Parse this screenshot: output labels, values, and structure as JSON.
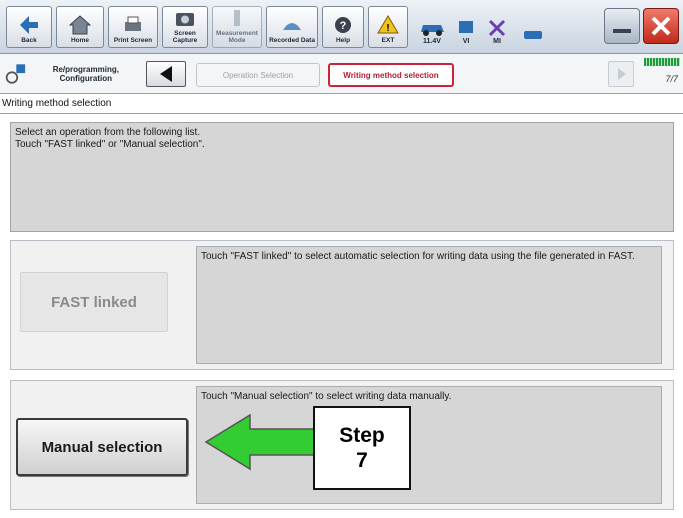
{
  "toolbar": {
    "buttons": [
      {
        "label": "Back"
      },
      {
        "label": "Home"
      },
      {
        "label": "Print Screen"
      },
      {
        "label": "Screen Capture"
      },
      {
        "label": "Measurement Mode"
      },
      {
        "label": "Recorded Data"
      },
      {
        "label": "Help"
      },
      {
        "label": "EXT"
      }
    ],
    "status": {
      "voltage": "11.4V",
      "vi": "VI",
      "mi": "MI"
    }
  },
  "nav": {
    "section_label": "Re/programming, Configuration",
    "crumbs": [
      {
        "label": "Operation Selection",
        "state": "inactive"
      },
      {
        "label": "Writing method selection",
        "state": "active"
      }
    ],
    "page_indicator": "7/7"
  },
  "page_title": "Writing method selection",
  "instructions": {
    "line1": "Select an operation from the following list.",
    "line2": "Touch \"FAST linked\" or \"Manual selection\"."
  },
  "options": {
    "fast": {
      "button_label": "FAST linked",
      "description": "Touch \"FAST linked\" to select automatic selection for writing data using the file generated in FAST.",
      "enabled": false
    },
    "manual": {
      "button_label": "Manual selection",
      "description": "Touch \"Manual selection\" to select writing data manually.",
      "enabled": true
    }
  },
  "callout": {
    "line1": "Step",
    "line2": "7",
    "arrow_color": "#33cc33"
  },
  "colors": {
    "active_crumb": "#c8253a",
    "callout_arrow": "#33cc33"
  }
}
